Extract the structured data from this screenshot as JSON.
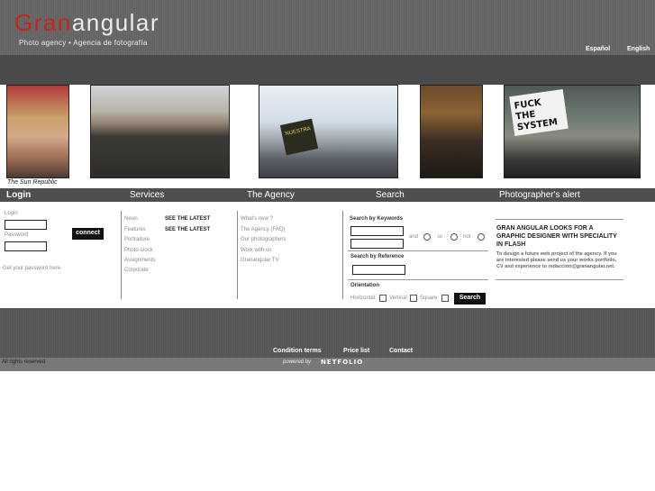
{
  "header": {
    "logo_part1": "Gran",
    "logo_part2": "angular",
    "tagline": "Photo agency • Agencia de fotografía",
    "lang_es": "Español",
    "lang_en": "English"
  },
  "photos": {
    "caption": "The Sun Republic",
    "sign_text_1": "FUCK THE SYSTEM",
    "sign_text_2": "NUESTRA"
  },
  "nav": {
    "login": "Login",
    "services": "Services",
    "agency": "The Agency",
    "search": "Search",
    "alert": "Photographer's alert"
  },
  "login": {
    "login_label": "Login",
    "password_label": "Password",
    "connect": "connect",
    "forgot": "Get your password here"
  },
  "services": {
    "items": [
      "News",
      "Features",
      "Portraiture",
      "Photo-stock",
      "Assignments",
      "Corporate"
    ],
    "see_latest_1": "SEE THE LATEST",
    "see_latest_2": "SEE THE LATEST"
  },
  "agency": {
    "items": [
      "What's new ?",
      "The Agency (FAQ)",
      "Our photographers",
      "Work with us",
      "Granangular TV"
    ]
  },
  "search": {
    "keywords_label": "Search by Keywords",
    "and": "and",
    "or": "or",
    "not": "not",
    "reference_label": "Search by Reference",
    "orientation_label": "Orientation",
    "horizontal": "Horizontal",
    "vertical": "Vertical",
    "square": "Square",
    "search_button": "Search"
  },
  "alert": {
    "title": "GRAN ANGULAR LOOKS FOR A GRAPHIC DESIGNER WITH SPECIALITY IN FLASH",
    "body": "To design a future web project of the agency. If you are interested please send us your works portfolio, CV and experience to redaccion@granangular.net."
  },
  "footer": {
    "conditions": "Condition terms",
    "prices": "Price list",
    "contact": "Contact",
    "rights": "All rights reserved",
    "powered": "powered by",
    "netfolio": "NETFOLIO"
  },
  "colors": {
    "logo_red": "#c3261b",
    "header_gray": "#666666",
    "nav_gray": "#4f4f4f"
  }
}
